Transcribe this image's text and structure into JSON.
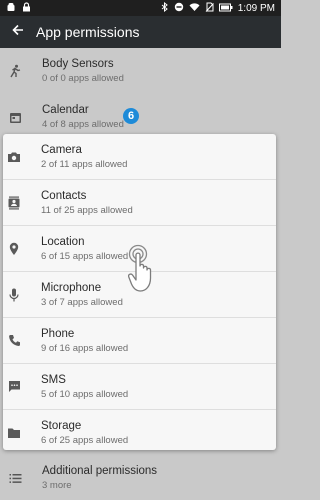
{
  "status_bar": {
    "time": "1:09 PM"
  },
  "app_bar": {
    "title": "App permissions"
  },
  "background_items": [
    {
      "label": "Body Sensors",
      "sub": "0 of 0 apps allowed",
      "icon": "run-icon"
    },
    {
      "label": "Calendar",
      "sub": "4 of 8 apps allowed",
      "icon": "calendar-icon"
    }
  ],
  "step_badge": "6",
  "permissions": [
    {
      "label": "Camera",
      "sub": "2 of 11 apps allowed",
      "icon": "camera-icon"
    },
    {
      "label": "Contacts",
      "sub": "11 of 25 apps allowed",
      "icon": "contacts-icon"
    },
    {
      "label": "Location",
      "sub": "6 of 15 apps allowed",
      "icon": "location-icon"
    },
    {
      "label": "Microphone",
      "sub": "3 of 7 apps allowed",
      "icon": "mic-icon"
    },
    {
      "label": "Phone",
      "sub": "9 of 16 apps allowed",
      "icon": "phone-icon"
    },
    {
      "label": "SMS",
      "sub": "5 of 10 apps allowed",
      "icon": "sms-icon"
    },
    {
      "label": "Storage",
      "sub": "6 of 25 apps allowed",
      "icon": "folder-icon"
    }
  ],
  "footer": {
    "label": "Additional permissions",
    "sub": "3 more",
    "icon": "list-icon"
  },
  "colors": {
    "accent": "#1e8bd8",
    "appbar": "#2a2e31",
    "statusbar": "#1f1f1f"
  }
}
